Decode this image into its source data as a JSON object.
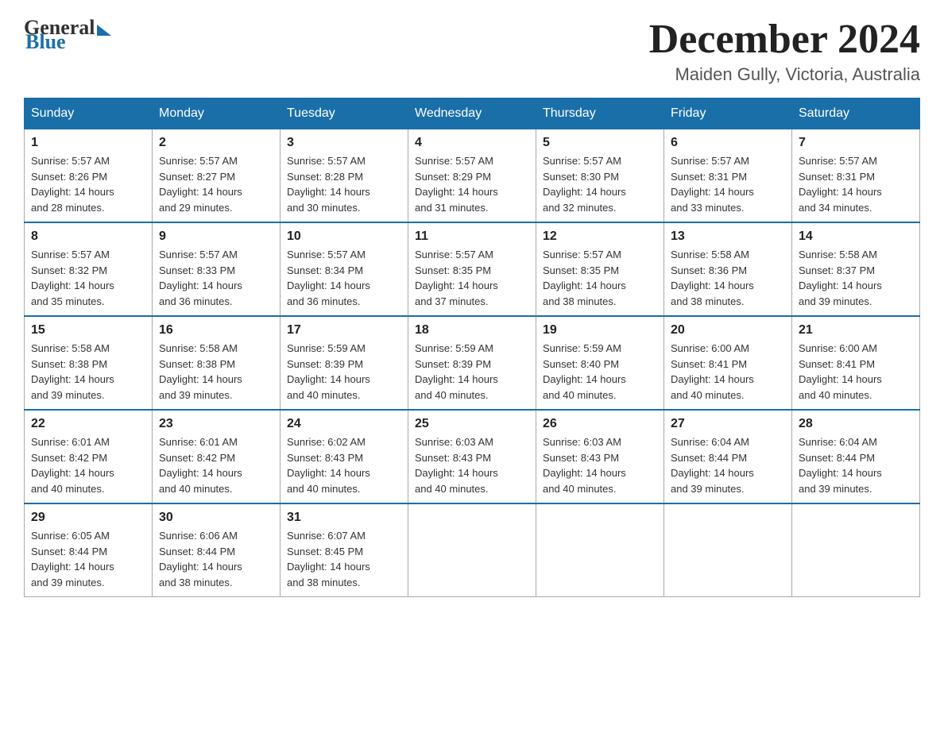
{
  "logo": {
    "general": "General",
    "blue": "Blue"
  },
  "title": "December 2024",
  "location": "Maiden Gully, Victoria, Australia",
  "days_of_week": [
    "Sunday",
    "Monday",
    "Tuesday",
    "Wednesday",
    "Thursday",
    "Friday",
    "Saturday"
  ],
  "weeks": [
    [
      {
        "day": "1",
        "info": "Sunrise: 5:57 AM\nSunset: 8:26 PM\nDaylight: 14 hours\nand 28 minutes."
      },
      {
        "day": "2",
        "info": "Sunrise: 5:57 AM\nSunset: 8:27 PM\nDaylight: 14 hours\nand 29 minutes."
      },
      {
        "day": "3",
        "info": "Sunrise: 5:57 AM\nSunset: 8:28 PM\nDaylight: 14 hours\nand 30 minutes."
      },
      {
        "day": "4",
        "info": "Sunrise: 5:57 AM\nSunset: 8:29 PM\nDaylight: 14 hours\nand 31 minutes."
      },
      {
        "day": "5",
        "info": "Sunrise: 5:57 AM\nSunset: 8:30 PM\nDaylight: 14 hours\nand 32 minutes."
      },
      {
        "day": "6",
        "info": "Sunrise: 5:57 AM\nSunset: 8:31 PM\nDaylight: 14 hours\nand 33 minutes."
      },
      {
        "day": "7",
        "info": "Sunrise: 5:57 AM\nSunset: 8:31 PM\nDaylight: 14 hours\nand 34 minutes."
      }
    ],
    [
      {
        "day": "8",
        "info": "Sunrise: 5:57 AM\nSunset: 8:32 PM\nDaylight: 14 hours\nand 35 minutes."
      },
      {
        "day": "9",
        "info": "Sunrise: 5:57 AM\nSunset: 8:33 PM\nDaylight: 14 hours\nand 36 minutes."
      },
      {
        "day": "10",
        "info": "Sunrise: 5:57 AM\nSunset: 8:34 PM\nDaylight: 14 hours\nand 36 minutes."
      },
      {
        "day": "11",
        "info": "Sunrise: 5:57 AM\nSunset: 8:35 PM\nDaylight: 14 hours\nand 37 minutes."
      },
      {
        "day": "12",
        "info": "Sunrise: 5:57 AM\nSunset: 8:35 PM\nDaylight: 14 hours\nand 38 minutes."
      },
      {
        "day": "13",
        "info": "Sunrise: 5:58 AM\nSunset: 8:36 PM\nDaylight: 14 hours\nand 38 minutes."
      },
      {
        "day": "14",
        "info": "Sunrise: 5:58 AM\nSunset: 8:37 PM\nDaylight: 14 hours\nand 39 minutes."
      }
    ],
    [
      {
        "day": "15",
        "info": "Sunrise: 5:58 AM\nSunset: 8:38 PM\nDaylight: 14 hours\nand 39 minutes."
      },
      {
        "day": "16",
        "info": "Sunrise: 5:58 AM\nSunset: 8:38 PM\nDaylight: 14 hours\nand 39 minutes."
      },
      {
        "day": "17",
        "info": "Sunrise: 5:59 AM\nSunset: 8:39 PM\nDaylight: 14 hours\nand 40 minutes."
      },
      {
        "day": "18",
        "info": "Sunrise: 5:59 AM\nSunset: 8:39 PM\nDaylight: 14 hours\nand 40 minutes."
      },
      {
        "day": "19",
        "info": "Sunrise: 5:59 AM\nSunset: 8:40 PM\nDaylight: 14 hours\nand 40 minutes."
      },
      {
        "day": "20",
        "info": "Sunrise: 6:00 AM\nSunset: 8:41 PM\nDaylight: 14 hours\nand 40 minutes."
      },
      {
        "day": "21",
        "info": "Sunrise: 6:00 AM\nSunset: 8:41 PM\nDaylight: 14 hours\nand 40 minutes."
      }
    ],
    [
      {
        "day": "22",
        "info": "Sunrise: 6:01 AM\nSunset: 8:42 PM\nDaylight: 14 hours\nand 40 minutes."
      },
      {
        "day": "23",
        "info": "Sunrise: 6:01 AM\nSunset: 8:42 PM\nDaylight: 14 hours\nand 40 minutes."
      },
      {
        "day": "24",
        "info": "Sunrise: 6:02 AM\nSunset: 8:43 PM\nDaylight: 14 hours\nand 40 minutes."
      },
      {
        "day": "25",
        "info": "Sunrise: 6:03 AM\nSunset: 8:43 PM\nDaylight: 14 hours\nand 40 minutes."
      },
      {
        "day": "26",
        "info": "Sunrise: 6:03 AM\nSunset: 8:43 PM\nDaylight: 14 hours\nand 40 minutes."
      },
      {
        "day": "27",
        "info": "Sunrise: 6:04 AM\nSunset: 8:44 PM\nDaylight: 14 hours\nand 39 minutes."
      },
      {
        "day": "28",
        "info": "Sunrise: 6:04 AM\nSunset: 8:44 PM\nDaylight: 14 hours\nand 39 minutes."
      }
    ],
    [
      {
        "day": "29",
        "info": "Sunrise: 6:05 AM\nSunset: 8:44 PM\nDaylight: 14 hours\nand 39 minutes."
      },
      {
        "day": "30",
        "info": "Sunrise: 6:06 AM\nSunset: 8:44 PM\nDaylight: 14 hours\nand 38 minutes."
      },
      {
        "day": "31",
        "info": "Sunrise: 6:07 AM\nSunset: 8:45 PM\nDaylight: 14 hours\nand 38 minutes."
      },
      null,
      null,
      null,
      null
    ]
  ]
}
